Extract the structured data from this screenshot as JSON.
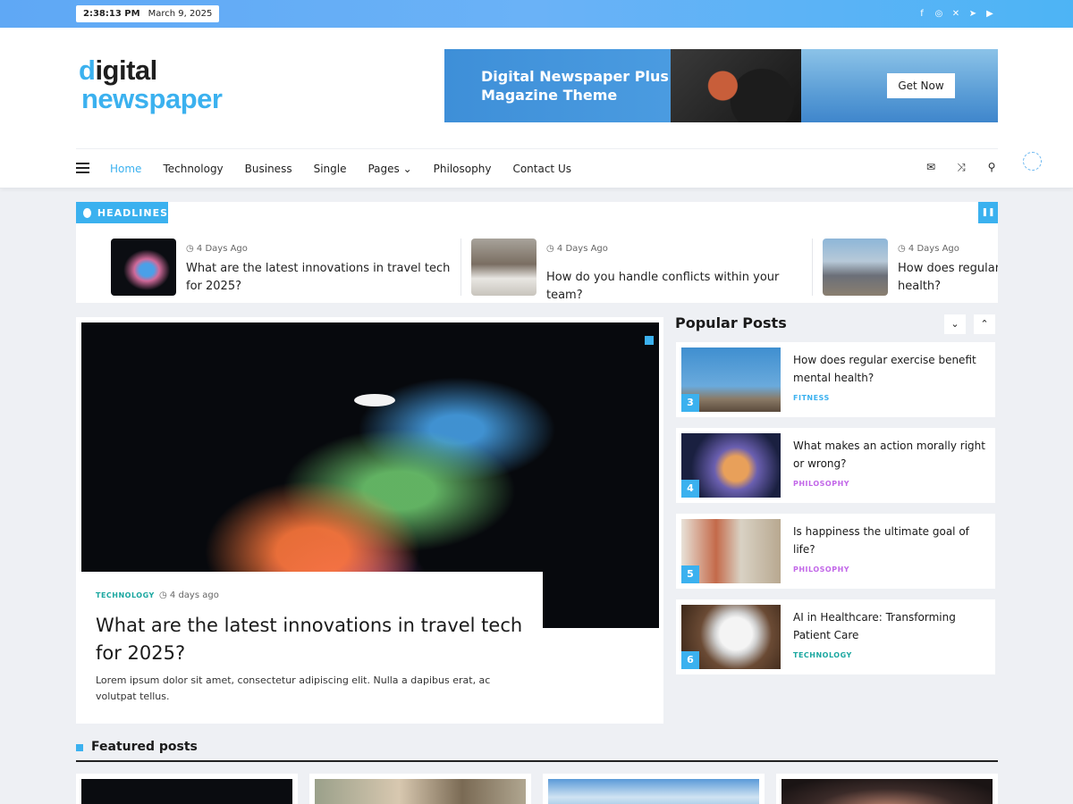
{
  "topbar": {
    "time": "2:38:13 PM",
    "date": "March 9, 2025",
    "social_icons": [
      "facebook-icon",
      "instagram-icon",
      "x-icon",
      "telegram-icon",
      "youtube-icon"
    ]
  },
  "logo": {
    "line1_first": "d",
    "line1_rest": "igital",
    "line2": "newspaper"
  },
  "banner": {
    "line1": "Digital Newspaper Plus",
    "line2": "Magazine Theme",
    "button": "Get Now"
  },
  "nav": {
    "items": [
      "Home",
      "Technology",
      "Business",
      "Single",
      "Pages",
      "Philosophy",
      "Contact Us"
    ],
    "pages_caret": "⌄",
    "icons": [
      "mail-icon",
      "shuffle-icon",
      "search-icon"
    ]
  },
  "headlines": {
    "label": "HEADLINES",
    "items": [
      {
        "time": "4 Days Ago",
        "title": "What are the latest innovations in travel tech for 2025?"
      },
      {
        "time": "4 Days Ago",
        "title": "How do you handle conflicts within your team?"
      },
      {
        "time": "4 Days Ago",
        "title": "How does regular exercise benefit mental health?"
      }
    ]
  },
  "feature": {
    "category": "TECHNOLOGY",
    "date": "4 days ago",
    "title": "What are the latest innovations in travel tech for 2025?",
    "excerpt": "Lorem ipsum dolor sit amet, consectetur adipiscing elit. Nulla a dapibus erat, ac volutpat tellus."
  },
  "popular": {
    "heading": "Popular Posts",
    "down": "⌄",
    "up": "⌃",
    "items": [
      {
        "num": "3",
        "title": "How does regular exercise benefit mental health?",
        "category": "FITNESS",
        "color": "#3bb1ef"
      },
      {
        "num": "4",
        "title": "What makes an action morally right or wrong?",
        "category": "PHILOSOPHY",
        "color": "#c267e8"
      },
      {
        "num": "5",
        "title": "Is happiness the ultimate goal of life?",
        "category": "PHILOSOPHY",
        "color": "#c267e8"
      },
      {
        "num": "6",
        "title": "AI in Healthcare: Transforming Patient Care",
        "category": "TECHNOLOGY",
        "color": "#1aa7a0"
      }
    ]
  },
  "featured": {
    "heading": "Featured posts"
  },
  "colors": {
    "accent": "#3bb1ef"
  }
}
